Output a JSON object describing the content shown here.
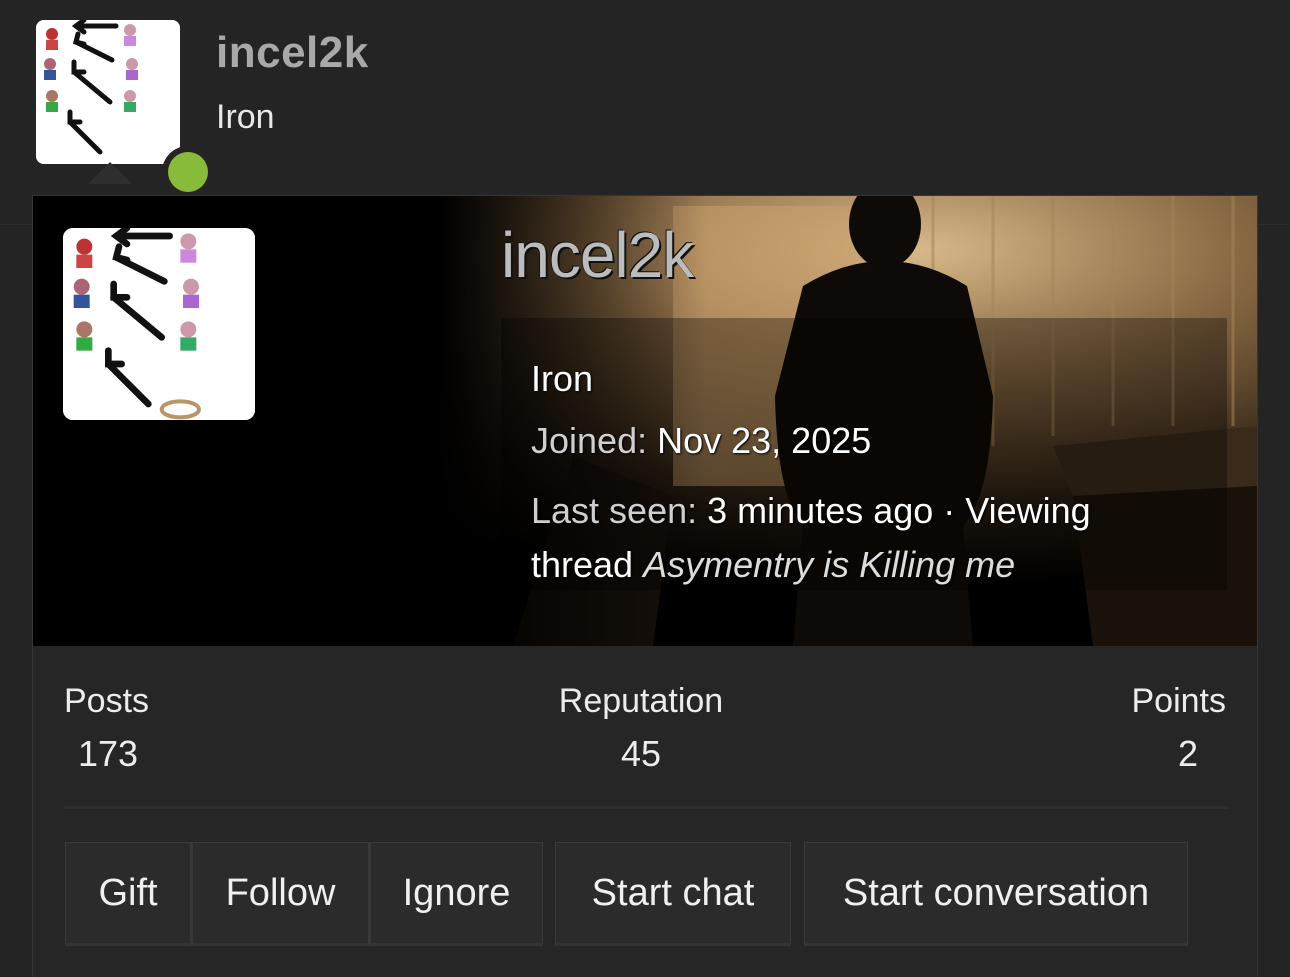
{
  "top_user": {
    "username": "incel2k",
    "title": "Iron",
    "status_color": "#88bb3a"
  },
  "card": {
    "username": "incel2k",
    "title": "Iron",
    "joined_label": "Joined:",
    "joined_value": "Nov 23, 2025",
    "last_seen_label": "Last seen:",
    "last_seen_value": "3 minutes ago · Viewing thread",
    "thread_name": "Asymentry is Killing me"
  },
  "stats": {
    "posts_label": "Posts",
    "posts_value": "173",
    "reputation_label": "Reputation",
    "reputation_value": "45",
    "points_label": "Points",
    "points_value": "2"
  },
  "actions": {
    "gift": "Gift",
    "follow": "Follow",
    "ignore": "Ignore",
    "start_chat": "Start chat",
    "start_conversation": "Start conversation"
  },
  "icons": {
    "avatar": "chipmunk-arrows-avatar",
    "online": "online-status-icon",
    "banner": "silhouette-banner-image"
  }
}
